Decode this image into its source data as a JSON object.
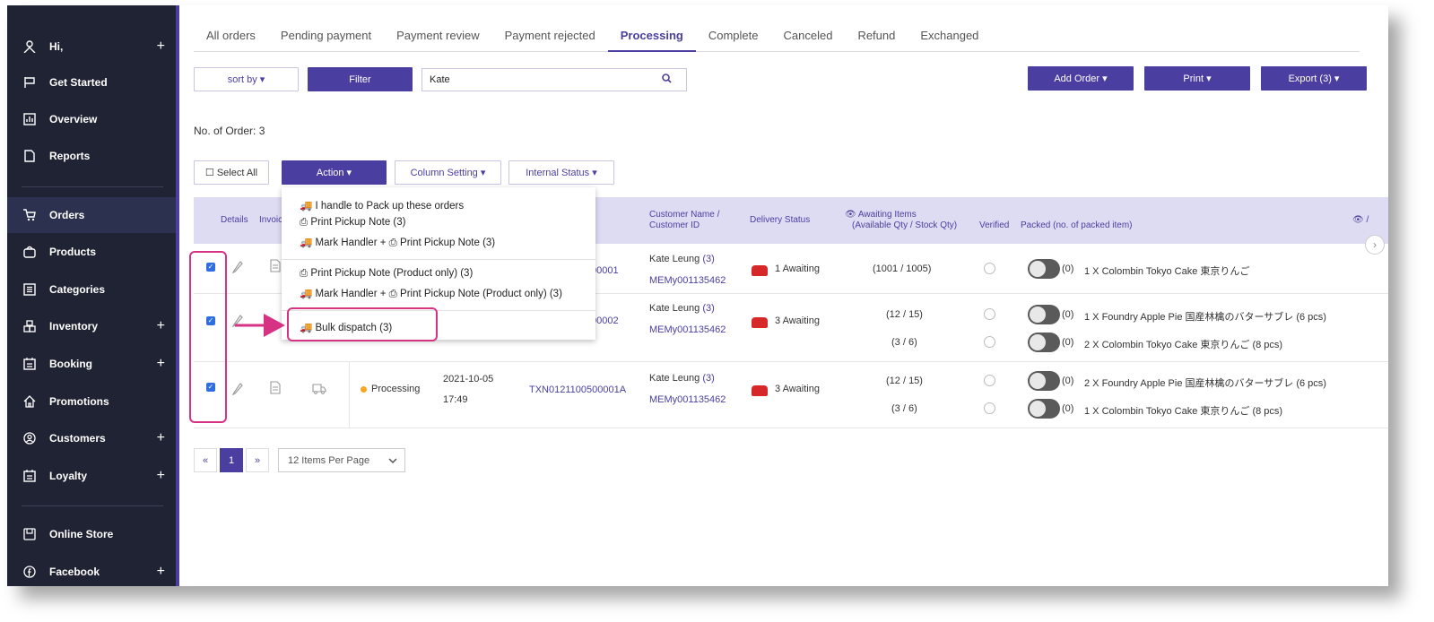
{
  "sidebar": {
    "items": [
      {
        "label": "Hi,",
        "icon": "user-icon",
        "plus": "+"
      },
      {
        "label": "Get Started",
        "icon": "flag-icon",
        "plus": ""
      },
      {
        "label": "Overview",
        "icon": "chart-icon",
        "plus": ""
      },
      {
        "label": "Reports",
        "icon": "document-icon",
        "plus": ""
      },
      {
        "label": "Orders",
        "icon": "cart-icon",
        "plus": ""
      },
      {
        "label": "Products",
        "icon": "bag-icon",
        "plus": ""
      },
      {
        "label": "Categories",
        "icon": "list-icon",
        "plus": ""
      },
      {
        "label": "Inventory",
        "icon": "boxes-icon",
        "plus": "+"
      },
      {
        "label": "Booking",
        "icon": "calendar-icon",
        "plus": "+"
      },
      {
        "label": "Promotions",
        "icon": "home-icon",
        "plus": ""
      },
      {
        "label": "Customers",
        "icon": "person-circle-icon",
        "plus": "+"
      },
      {
        "label": "Loyalty",
        "icon": "calendar-icon",
        "plus": "+"
      },
      {
        "label": "Online Store",
        "icon": "store-icon",
        "plus": ""
      },
      {
        "label": "Facebook",
        "icon": "facebook-icon",
        "plus": "+"
      }
    ]
  },
  "tabs": [
    "All orders",
    "Pending payment",
    "Payment review",
    "Payment rejected",
    "Processing",
    "Complete",
    "Canceled",
    "Refund",
    "Exchanged"
  ],
  "active_tab": "Processing",
  "toolbar": {
    "sort_label": "sort by ▾",
    "filter_label": "Filter",
    "search_value": "Kate",
    "add_order_label": "Add Order ▾",
    "print_label": "Print ▾",
    "export_label": "Export (3) ▾"
  },
  "order_count": "No. of Order: 3",
  "actions": {
    "select_all": "☐ Select All",
    "action": "Action ▾",
    "column_setting": "Column Setting ▾",
    "internal_status": "Internal Status ▾"
  },
  "dropdown": {
    "items": [
      "🚚 I handle to Pack up these orders",
      "⎙ Print Pickup Note (3)",
      "🚚 Mark Handler + ⎙ Print Pickup Note (3)",
      "⎙ Print Pickup Note (Product only) (3)",
      "🚚 Mark Handler + ⎙ Print Pickup Note (Product only) (3)",
      "🚚 Bulk dispatch (3)"
    ]
  },
  "table": {
    "headers": {
      "details": "Details",
      "invoice": "Invoic",
      "customer": "Customer Name /",
      "customer2": "Customer ID",
      "delivery": "Delivery Status",
      "awaiting": "👁 Awaiting Items",
      "awaiting2": "(Available Qty / Stock Qty)",
      "verified": "Verified",
      "packed": "Packed (no. of packed item)",
      "eye": "👁 /"
    },
    "rows": [
      {
        "txn": "00001",
        "customer_name": "Kate Leung",
        "customer_count": "(3)",
        "customer_id": "MEMy001135462",
        "delivery": "1 Awaiting",
        "items": [
          {
            "qty": "(1001 / 1005)",
            "packed": "(0)",
            "product": "1 X Colombin Tokyo Cake 東京りんご"
          }
        ]
      },
      {
        "txn": "00002",
        "customer_name": "Kate Leung",
        "customer_count": "(3)",
        "customer_id": "MEMy001135462",
        "delivery": "3 Awaiting",
        "items": [
          {
            "qty": "(12 / 15)",
            "packed": "(0)",
            "product": "1 X Foundry Apple Pie 国産林檎のバターサブレ (6 pcs)"
          },
          {
            "qty": "(3 / 6)",
            "packed": "(0)",
            "product": "2 X Colombin Tokyo Cake 東京りんご (8 pcs)"
          }
        ]
      },
      {
        "status": "Processing",
        "date": "2021-10-05",
        "time": "17:49",
        "txn": "TXN0121100500001A",
        "customer_name": "Kate Leung",
        "customer_count": "(3)",
        "customer_id": "MEMy001135462",
        "delivery": "3 Awaiting",
        "items": [
          {
            "qty": "(12 / 15)",
            "packed": "(0)",
            "product": "2 X Foundry Apple Pie 国産林檎のバターサブレ (6 pcs)"
          },
          {
            "qty": "(3 / 6)",
            "packed": "(0)",
            "product": "1 X Colombin Tokyo Cake 東京りんご (8 pcs)"
          }
        ]
      }
    ]
  },
  "pager": {
    "prev": "«",
    "page": "1",
    "next": "»",
    "per_page": "12 Items Per Page"
  },
  "colors": {
    "accent": "#4a3fa0",
    "sidebar": "#1f2333",
    "highlight": "#d63384"
  }
}
